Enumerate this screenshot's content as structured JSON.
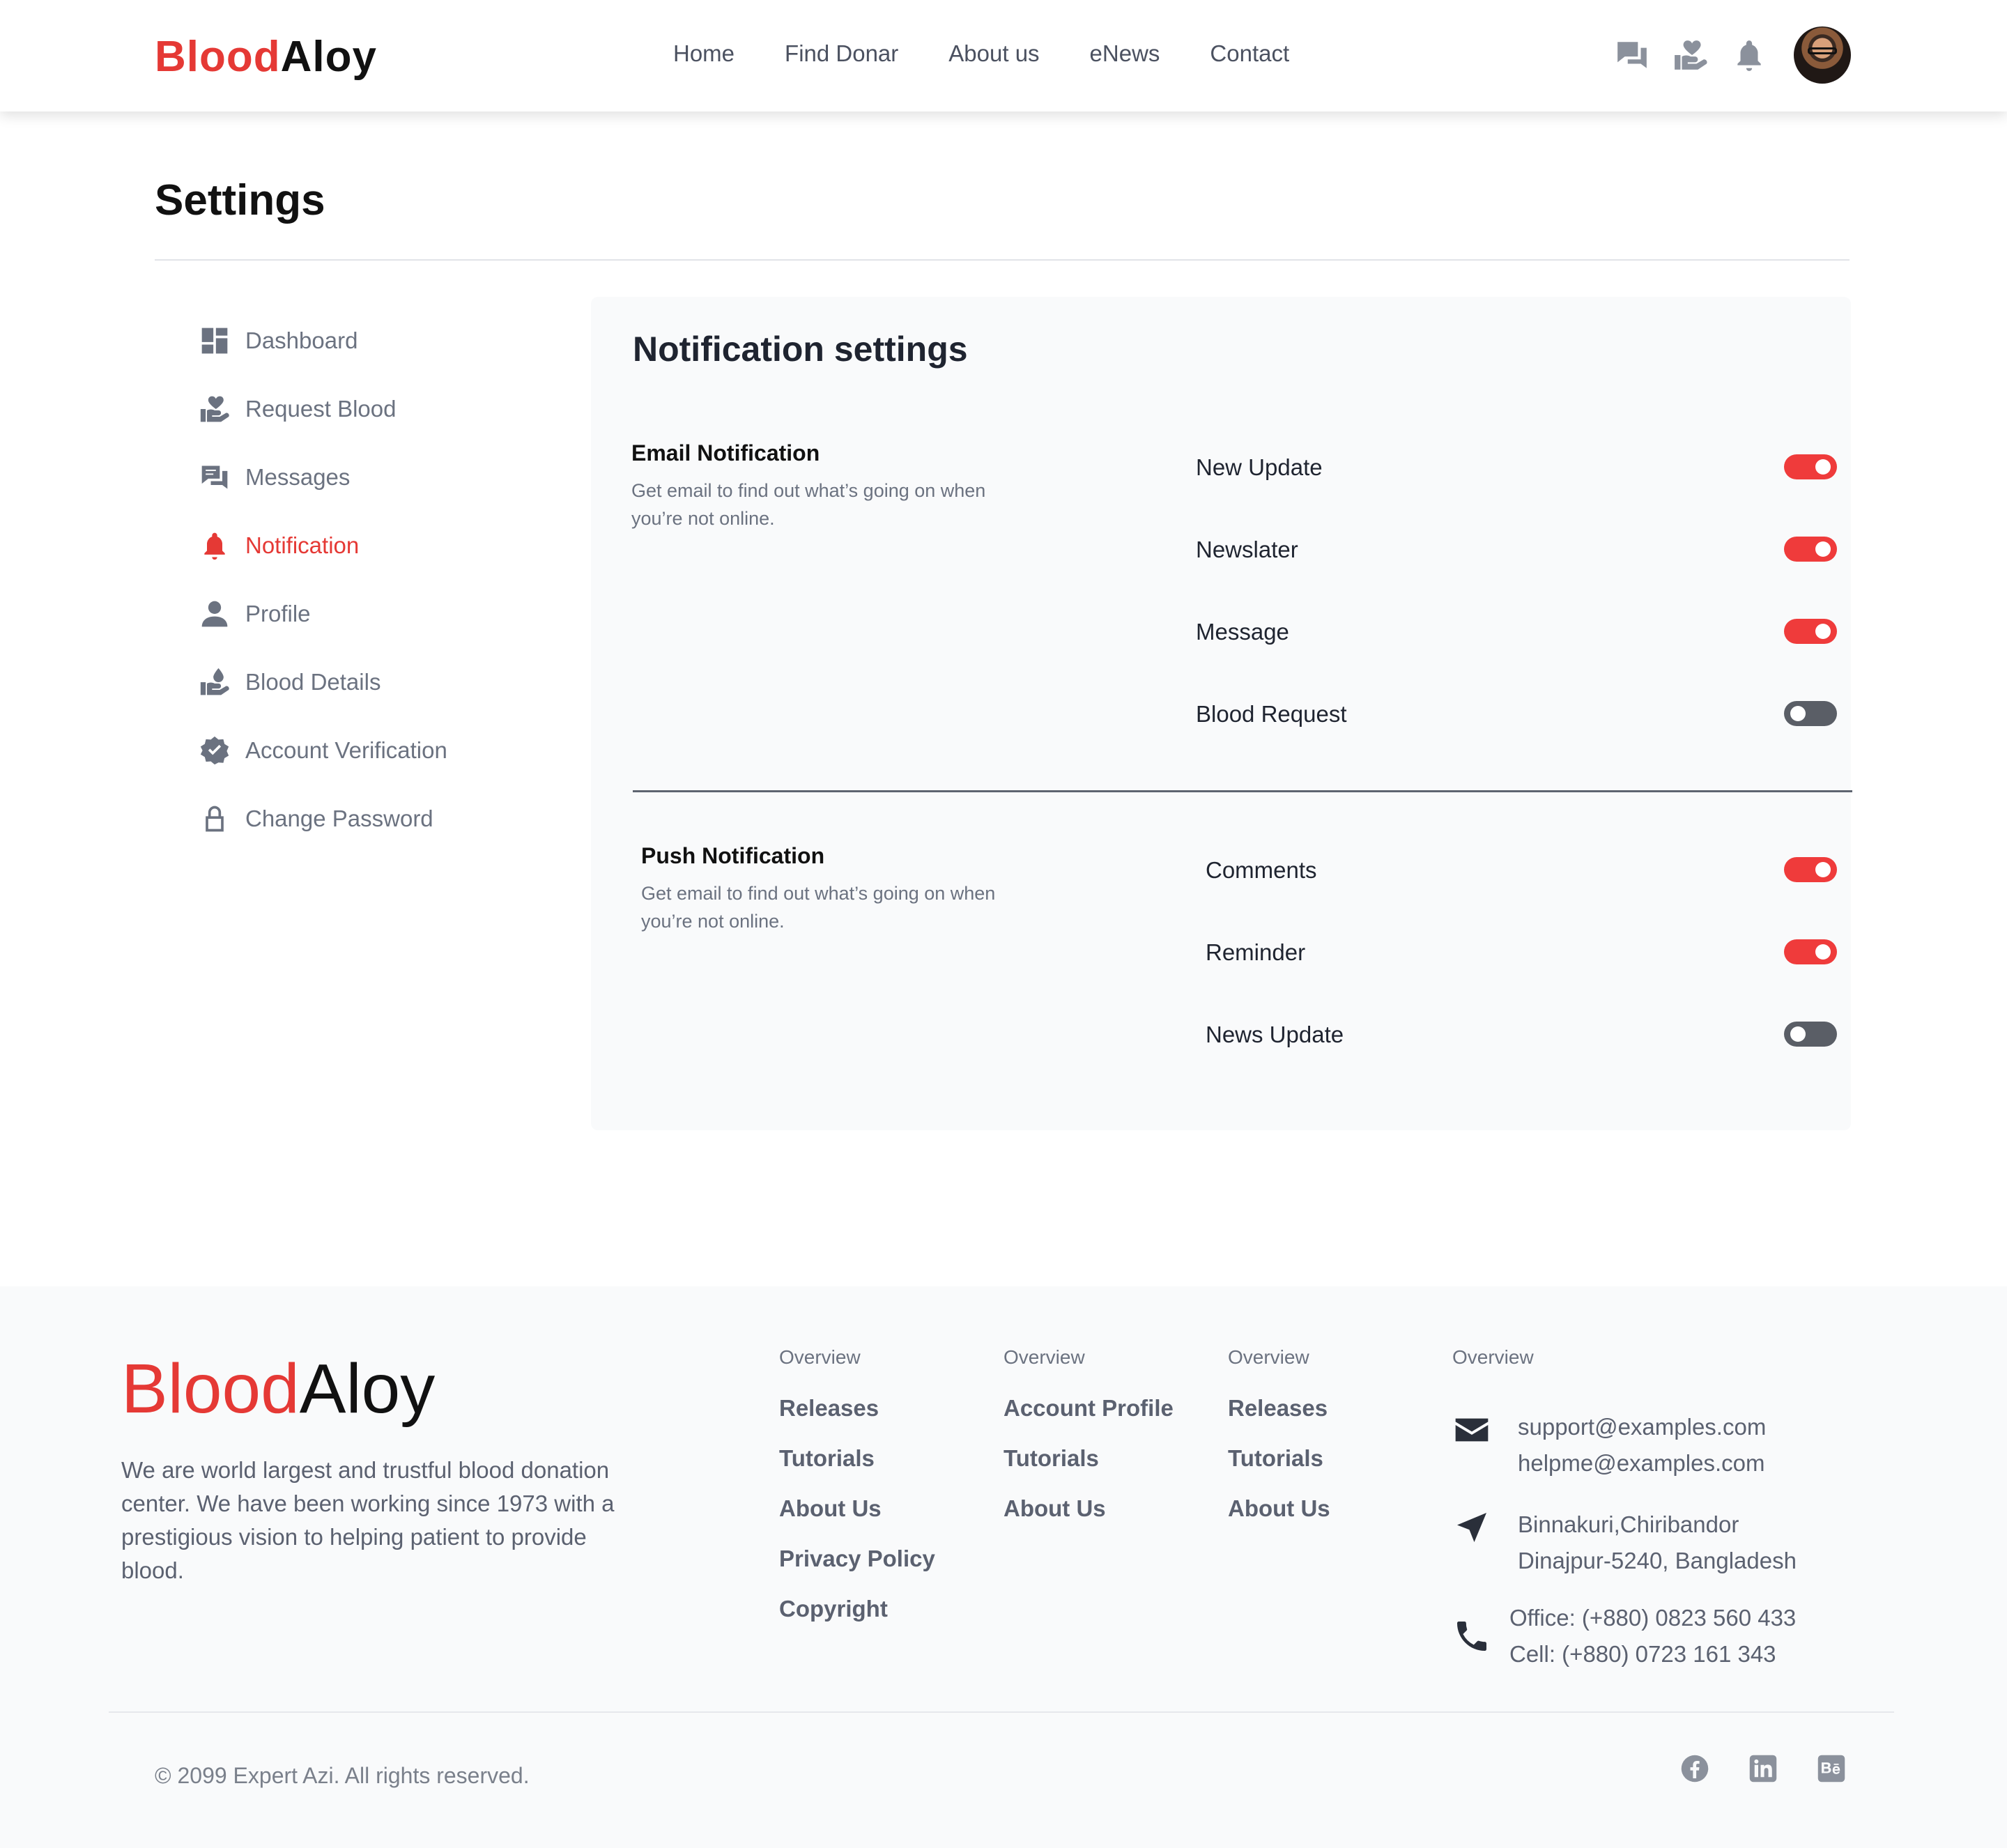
{
  "brand": {
    "part1": "Blood",
    "part2": "Aloy"
  },
  "nav": {
    "items": [
      "Home",
      "Find Donar",
      "About us",
      "eNews",
      "Contact"
    ]
  },
  "header_icons": [
    "messages-icon",
    "request-blood-icon",
    "bell-icon"
  ],
  "page": {
    "title": "Settings"
  },
  "sidebar": {
    "items": [
      {
        "label": "Dashboard",
        "icon": "dashboard-icon"
      },
      {
        "label": "Request Blood",
        "icon": "hand-heart-icon"
      },
      {
        "label": "Messages",
        "icon": "messages-icon"
      },
      {
        "label": "Notification",
        "icon": "bell-icon",
        "active": true
      },
      {
        "label": "Profile",
        "icon": "user-icon"
      },
      {
        "label": "Blood Details",
        "icon": "blood-drop-hand-icon"
      },
      {
        "label": "Account Verification",
        "icon": "verified-badge-icon"
      },
      {
        "label": "Change Password",
        "icon": "lock-icon"
      }
    ]
  },
  "panel": {
    "title": "Notification settings",
    "email": {
      "heading": "Email Notification",
      "description": "Get email to find out what’s going on when you’re not online.",
      "options": [
        {
          "label": "New Update",
          "on": true
        },
        {
          "label": "Newslater",
          "on": true
        },
        {
          "label": "Message",
          "on": true
        },
        {
          "label": "Blood Request",
          "on": false
        }
      ]
    },
    "push": {
      "heading": "Push Notification",
      "description": "Get email to find out what’s going on when you’re not online.",
      "options": [
        {
          "label": "Comments",
          "on": true
        },
        {
          "label": "Reminder",
          "on": true
        },
        {
          "label": "News Update",
          "on": false
        }
      ]
    }
  },
  "footer": {
    "description": "We are world largest and trustful blood donation center. We have been working since 1973 with a prestigious vision to helping patient to provide blood.",
    "columns": [
      {
        "heading": "Overview",
        "links": [
          "Releases",
          "Tutorials",
          "About Us",
          "Privacy Policy",
          "Copyright"
        ]
      },
      {
        "heading": "Overview",
        "links": [
          "Account Profile",
          "Tutorials",
          "About Us"
        ]
      },
      {
        "heading": "Overview",
        "links": [
          "Releases",
          "Tutorials",
          "About Us"
        ]
      }
    ],
    "contact": {
      "heading": "Overview",
      "email": [
        "support@examples.com",
        "helpme@examples.com"
      ],
      "address": [
        "Binnakuri,Chiribandor",
        "Dinajpur-5240, Bangladesh"
      ],
      "phone": [
        "Office: (+880) 0823 560 433",
        "Cell: (+880) 0723 161 343"
      ]
    },
    "copyright": "© 2099 Expert Azi. All rights reserved.",
    "social": [
      "facebook-icon",
      "linkedin-icon",
      "behance-icon"
    ]
  },
  "colors": {
    "accent": "#e53935",
    "toggle_on": "#ef3b3b",
    "toggle_off": "#5a5e66"
  }
}
